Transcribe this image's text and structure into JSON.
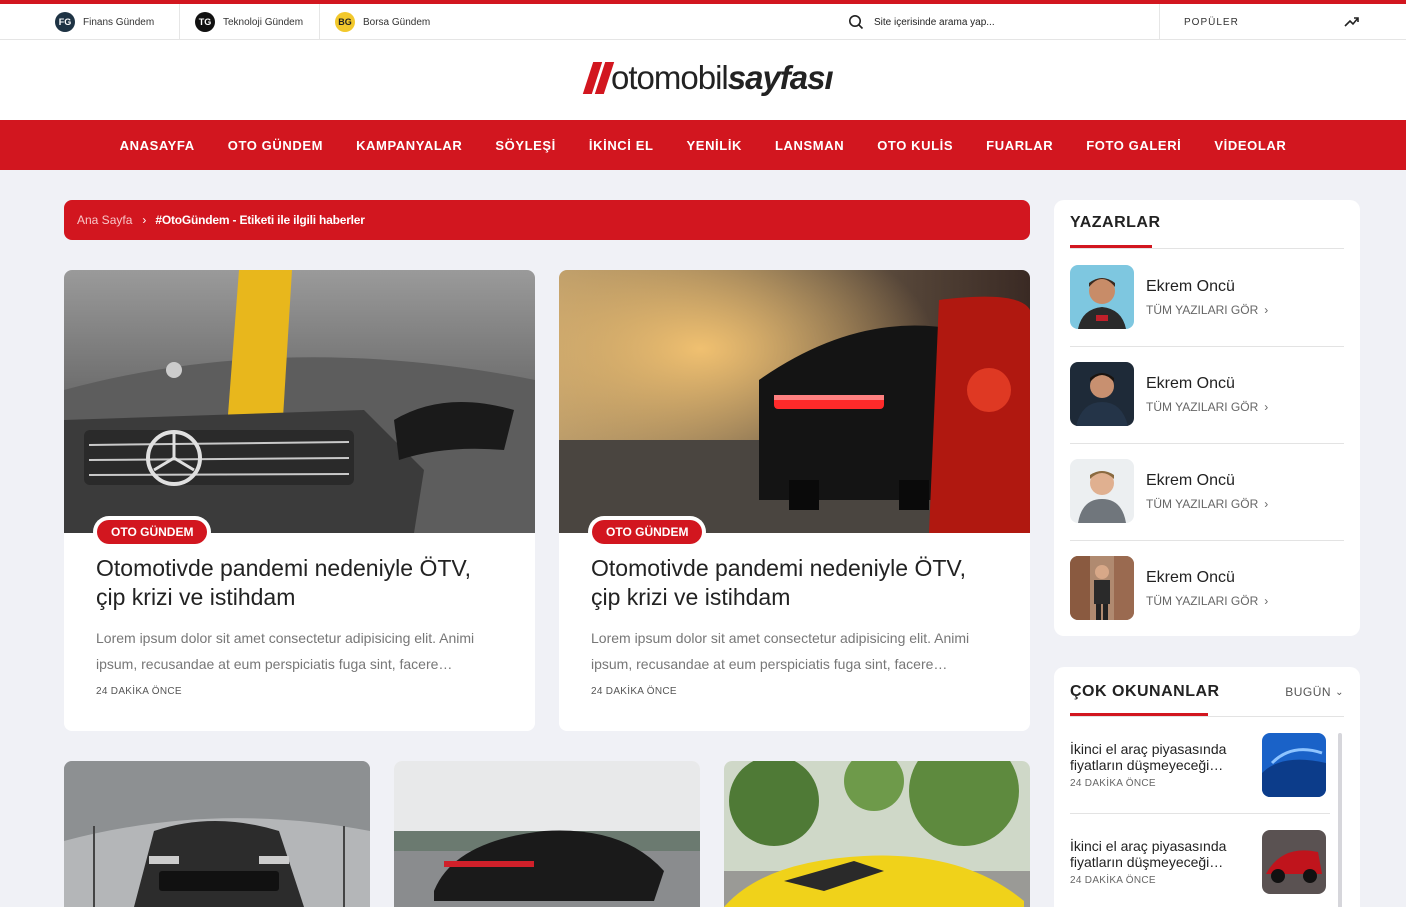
{
  "topbar": {
    "sites": [
      {
        "badge": "FG",
        "label": "Finans Gündem",
        "color": "#1e3344"
      },
      {
        "badge": "TG",
        "label": "Teknoloji Gündem",
        "color": "#111111"
      },
      {
        "badge": "BG",
        "label": "Borsa Gündem",
        "color": "#f2c82c"
      }
    ],
    "search_placeholder": "Site içerisinde arama yap...",
    "popular_label": "POPÜLER"
  },
  "logo": {
    "part1": "otomobil",
    "part2": "sayfası"
  },
  "nav": [
    "ANASAYFA",
    "OTO GÜNDEM",
    "KAMPANYALAR",
    "SÖYLEŞİ",
    "İKİNCİ EL",
    "YENİLİK",
    "LANSMAN",
    "OTO KULİS",
    "FUARLAR",
    "FOTO GALERİ",
    "VİDEOLAR"
  ],
  "breadcrumb": {
    "home": "Ana Sayfa",
    "current": "#OtoGündem - Etiketi ile ilgili haberler"
  },
  "articles": [
    {
      "tag": "OTO GÜNDEM",
      "title": "Otomotivde pandemi nedeniyle ÖTV, çip krizi ve istihdam",
      "excerpt": "Lorem ipsum dolor sit amet consectetur adipisicing elit. Animi ipsum, recusandae at eum perspiciatis fuga sint, facere…",
      "time": "24 DAKİKA ÖNCE"
    },
    {
      "tag": "OTO GÜNDEM",
      "title": "Otomotivde pandemi nedeniyle ÖTV, çip krizi ve istihdam",
      "excerpt": "Lorem ipsum dolor sit amet consectetur adipisicing elit. Animi ipsum, recusandae at eum perspiciatis fuga sint, facere…",
      "time": "24 DAKİKA ÖNCE"
    }
  ],
  "authors": {
    "title": "YAZARLAR",
    "items": [
      {
        "name": "Ekrem Oncü",
        "link": "TÜM YAZILARI GÖR"
      },
      {
        "name": "Ekrem Oncü",
        "link": "TÜM YAZILARI GÖR"
      },
      {
        "name": "Ekrem Oncü",
        "link": "TÜM YAZILARI GÖR"
      },
      {
        "name": "Ekrem Oncü",
        "link": "TÜM YAZILARI GÖR"
      }
    ]
  },
  "most_read": {
    "title": "ÇOK OKUNANLAR",
    "sort": "BUGÜN",
    "items": [
      {
        "title": "İkinci el araç piyasasında fiyatların düşmeyeceği…",
        "time": "24 DAKİKA ÖNCE"
      },
      {
        "title": "İkinci el araç piyasasında fiyatların düşmeyeceği…",
        "time": "24 DAKİKA ÖNCE"
      }
    ]
  },
  "colors": {
    "accent": "#d2161f",
    "background": "#f0f1f6"
  }
}
